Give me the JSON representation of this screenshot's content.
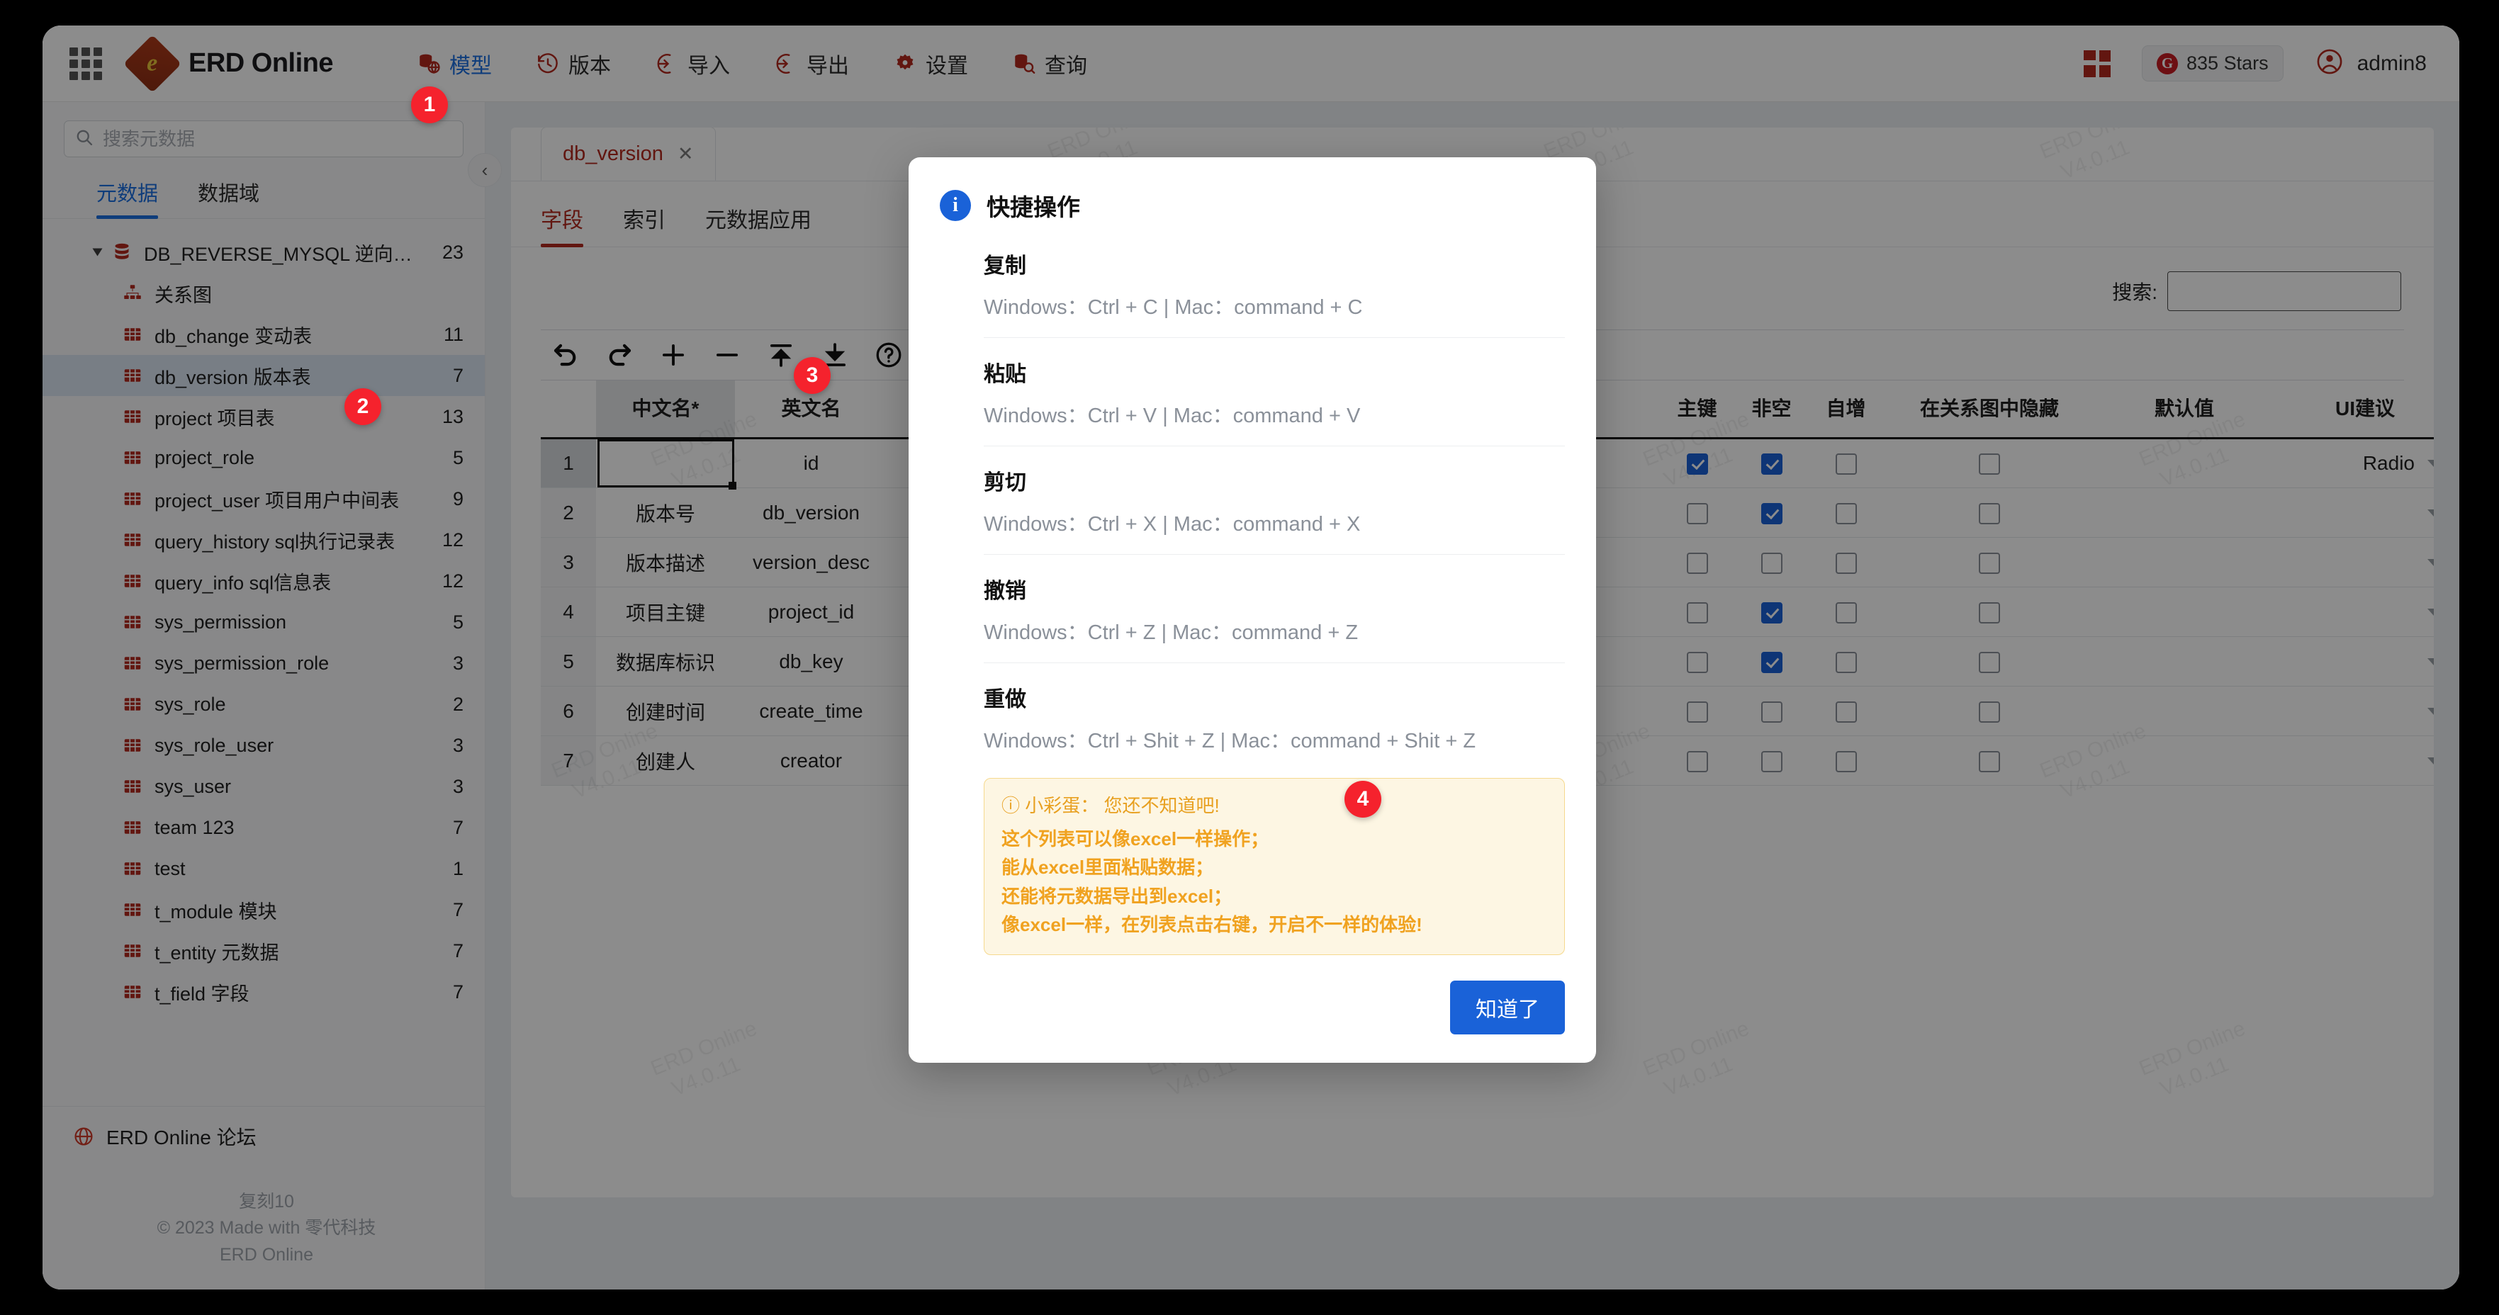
{
  "header": {
    "brand": "ERD Online",
    "nav": [
      {
        "label": "模型",
        "icon": "database-globe-icon",
        "active": true
      },
      {
        "label": "版本",
        "icon": "history-clock-icon",
        "active": false
      },
      {
        "label": "导入",
        "icon": "import-arrow-icon",
        "active": false
      },
      {
        "label": "导出",
        "icon": "export-arrow-icon",
        "active": false
      },
      {
        "label": "设置",
        "icon": "gear-icon",
        "active": false
      },
      {
        "label": "查询",
        "icon": "database-search-icon",
        "active": false
      }
    ],
    "stars_label": "835 Stars",
    "user_name": "admin8"
  },
  "sidebar": {
    "search_placeholder": "搜索元数据",
    "tabs": [
      {
        "label": "元数据",
        "active": true
      },
      {
        "label": "数据域",
        "active": false
      }
    ],
    "root": {
      "label": "DB_REVERSE_MYSQL 逆向解...",
      "count": "23"
    },
    "relation_graph": "关系图",
    "tables": [
      {
        "label": "db_change 变动表",
        "count": "11",
        "selected": false
      },
      {
        "label": "db_version 版本表",
        "count": "7",
        "selected": true
      },
      {
        "label": "project 项目表",
        "count": "13",
        "selected": false
      },
      {
        "label": "project_role",
        "count": "5",
        "selected": false
      },
      {
        "label": "project_user 项目用户中间表",
        "count": "9",
        "selected": false
      },
      {
        "label": "query_history sql执行记录表",
        "count": "12",
        "selected": false
      },
      {
        "label": "query_info sql信息表",
        "count": "12",
        "selected": false
      },
      {
        "label": "sys_permission",
        "count": "5",
        "selected": false
      },
      {
        "label": "sys_permission_role",
        "count": "3",
        "selected": false
      },
      {
        "label": "sys_role",
        "count": "2",
        "selected": false
      },
      {
        "label": "sys_role_user",
        "count": "3",
        "selected": false
      },
      {
        "label": "sys_user",
        "count": "3",
        "selected": false
      },
      {
        "label": "team 123",
        "count": "7",
        "selected": false
      },
      {
        "label": "test",
        "count": "1",
        "selected": false
      },
      {
        "label": "t_module 模块",
        "count": "7",
        "selected": false
      },
      {
        "label": "t_entity 元数据",
        "count": "7",
        "selected": false
      },
      {
        "label": "t_field 字段",
        "count": "7",
        "selected": false
      }
    ],
    "forum_label": "ERD Online 论坛",
    "copyright_line1": "复刻10",
    "copyright_line2": "© 2023 Made with 零代科技",
    "copyright_line3": "ERD Online"
  },
  "main": {
    "doc_tab": "db_version",
    "doc_tab_close": "✕",
    "subtabs": [
      {
        "label": "字段",
        "active": true
      },
      {
        "label": "索引",
        "active": false
      },
      {
        "label": "元数据应用",
        "active": false
      }
    ],
    "search_label": "搜索:",
    "search_value": "",
    "toolbar": [
      {
        "name": "undo-icon"
      },
      {
        "name": "redo-icon"
      },
      {
        "name": "plus-icon"
      },
      {
        "name": "minus-icon"
      },
      {
        "name": "upload-icon"
      },
      {
        "name": "download-icon"
      },
      {
        "name": "help-icon"
      }
    ],
    "table": {
      "columns": [
        "中文名*",
        "英文名",
        "主键",
        "非空",
        "自增",
        "在关系图中隐藏",
        "默认值",
        "UI建议"
      ],
      "rows": [
        {
          "num": "1",
          "cn": "",
          "en": "id",
          "pk": true,
          "nn": true,
          "ai": false,
          "hide": false,
          "def": "",
          "ui": "Radio"
        },
        {
          "num": "2",
          "cn": "版本号",
          "en": "db_version",
          "pk": false,
          "nn": true,
          "ai": false,
          "hide": false,
          "def": "",
          "ui": ""
        },
        {
          "num": "3",
          "cn": "版本描述",
          "en": "version_desc",
          "pk": false,
          "nn": false,
          "ai": false,
          "hide": false,
          "def": "",
          "ui": ""
        },
        {
          "num": "4",
          "cn": "项目主键",
          "en": "project_id",
          "pk": false,
          "nn": true,
          "ai": false,
          "hide": false,
          "def": "",
          "ui": ""
        },
        {
          "num": "5",
          "cn": "数据库标识",
          "en": "db_key",
          "pk": false,
          "nn": true,
          "ai": false,
          "hide": false,
          "def": "",
          "ui": ""
        },
        {
          "num": "6",
          "cn": "创建时间",
          "en": "create_time",
          "pk": false,
          "nn": false,
          "ai": false,
          "hide": false,
          "def": "",
          "ui": ""
        },
        {
          "num": "7",
          "cn": "创建人",
          "en": "creator",
          "pk": false,
          "nn": false,
          "ai": false,
          "hide": false,
          "def": "",
          "ui": ""
        }
      ]
    },
    "watermark": "ERD Online\n  V4.0.11"
  },
  "modal": {
    "title": "快捷操作",
    "shortcuts": [
      {
        "name": "复制",
        "keys": "Windows：Ctrl + C | Mac：command + C"
      },
      {
        "name": "粘贴",
        "keys": "Windows：Ctrl + V | Mac：command + V"
      },
      {
        "name": "剪切",
        "keys": "Windows：Ctrl + X | Mac：command + X"
      },
      {
        "name": "撤销",
        "keys": "Windows：Ctrl + Z | Mac：command + Z"
      },
      {
        "name": "重做",
        "keys": "Windows：Ctrl + Shit + Z | Mac：command + Shit + Z"
      }
    ],
    "egg_title": "小彩蛋： 您还不知道吧!",
    "egg_lines": [
      "这个列表可以像excel一样操作；",
      "能从excel里面粘贴数据；",
      "还能将元数据导出到excel；",
      "像excel一样，在列表点击右键，开启不一样的体验!"
    ],
    "confirm_label": "知道了"
  },
  "steps": [
    {
      "label": "1"
    },
    {
      "label": "2"
    },
    {
      "label": "3"
    },
    {
      "label": "4"
    }
  ],
  "colors": {
    "accent_blue": "#1a62d8",
    "brand_red": "#b3281e",
    "step_red": "#f5222d",
    "egg_orange": "#f0a220"
  }
}
